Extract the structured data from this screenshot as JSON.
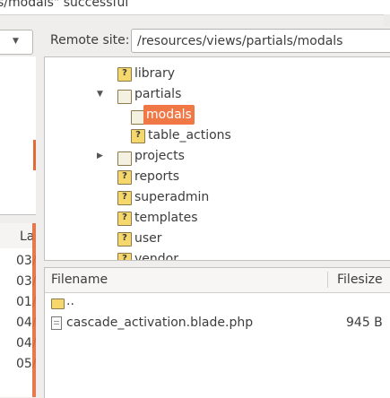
{
  "status": {
    "message": "s/modals\" successful"
  },
  "local": {
    "list_header_label": "La",
    "dates": [
      "03/",
      "03/",
      "01/",
      "04/",
      "04/",
      "05/"
    ]
  },
  "remote": {
    "site_label": "Remote site:",
    "path": "/resources/views/partials/modals",
    "tree": [
      {
        "label": "library",
        "icon": "question-folder-icon",
        "expander": ""
      },
      {
        "label": "partials",
        "icon": "folder-icon",
        "expander": "▼"
      },
      {
        "label": "modals",
        "icon": "open-folder-icon",
        "expander": "",
        "selected": true
      },
      {
        "label": "table_actions",
        "icon": "question-folder-icon",
        "expander": ""
      },
      {
        "label": "projects",
        "icon": "folder-icon",
        "expander": "▶"
      },
      {
        "label": "reports",
        "icon": "question-folder-icon",
        "expander": ""
      },
      {
        "label": "superadmin",
        "icon": "question-folder-icon",
        "expander": ""
      },
      {
        "label": "templates",
        "icon": "question-folder-icon",
        "expander": ""
      },
      {
        "label": "user",
        "icon": "question-folder-icon",
        "expander": ""
      },
      {
        "label": "vendor",
        "icon": "question-folder-icon",
        "expander": ""
      }
    ],
    "list": {
      "columns": {
        "filename": "Filename",
        "filesize": "Filesize"
      },
      "rows": [
        {
          "name": "..",
          "size": "",
          "icon": "folder-icon"
        },
        {
          "name": "cascade_activation.blade.php",
          "size": "945 B",
          "icon": "document-icon"
        }
      ]
    }
  },
  "colors": {
    "accent": "#f07746",
    "background": "#efeeec"
  }
}
